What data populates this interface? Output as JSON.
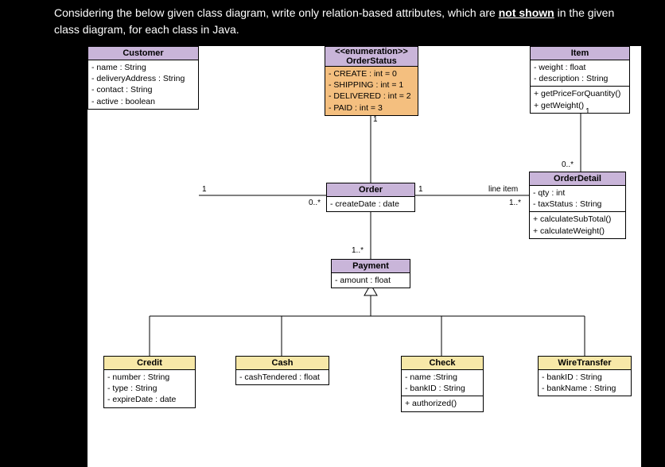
{
  "question": {
    "prefix": "Considering the below given class diagram, write only relation-based attributes, which are ",
    "underline": "not shown",
    "suffix": " in the given class diagram, for each class in Java."
  },
  "classes": {
    "orderStatus": {
      "stereo": "<<enumeration>>",
      "name": "OrderStatus",
      "attrs": [
        "- CREATE : int  = 0",
        "- SHIPPING : int = 1",
        "- DELIVERED : int = 2",
        "- PAID : int = 3"
      ]
    },
    "item": {
      "name": "Item",
      "attrs": [
        "- weight : float",
        "- description : String"
      ],
      "ops": [
        "+ getPriceForQuantity()",
        "+ getWeight()"
      ]
    },
    "customer": {
      "name": "Customer",
      "attrs": [
        "- name : String",
        "- deliveryAddress : String",
        "- contact : String",
        "- active : boolean"
      ]
    },
    "order": {
      "name": "Order",
      "attrs": [
        "- createDate : date"
      ]
    },
    "orderDetail": {
      "name": "OrderDetail",
      "attrs": [
        "- qty : int",
        "- taxStatus : String"
      ],
      "ops": [
        "+ calculateSubTotal()",
        "+ calculateWeight()"
      ]
    },
    "payment": {
      "name": "Payment",
      "attrs": [
        "- amount : float"
      ]
    },
    "credit": {
      "name": "Credit",
      "attrs": [
        "- number : String",
        "- type : String",
        "- expireDate : date"
      ]
    },
    "cash": {
      "name": "Cash",
      "attrs": [
        "- cashTendered : float"
      ]
    },
    "check": {
      "name": "Check",
      "attrs": [
        "- name :String",
        "- bankID : String"
      ],
      "ops": [
        "+ authorized()"
      ]
    },
    "wireTransfer": {
      "name": "WireTransfer",
      "attrs": [
        "- bankID : String",
        "- bankName : String"
      ]
    }
  },
  "labels": {
    "os_order": "1",
    "cust_order_1": "1",
    "cust_order_n": "0..*",
    "order_detail_1": "1",
    "order_detail_name": "line item",
    "order_detail_n": "1..*",
    "item_detail_1": "1",
    "item_detail_n": "0..*",
    "order_payment": "1..*"
  }
}
